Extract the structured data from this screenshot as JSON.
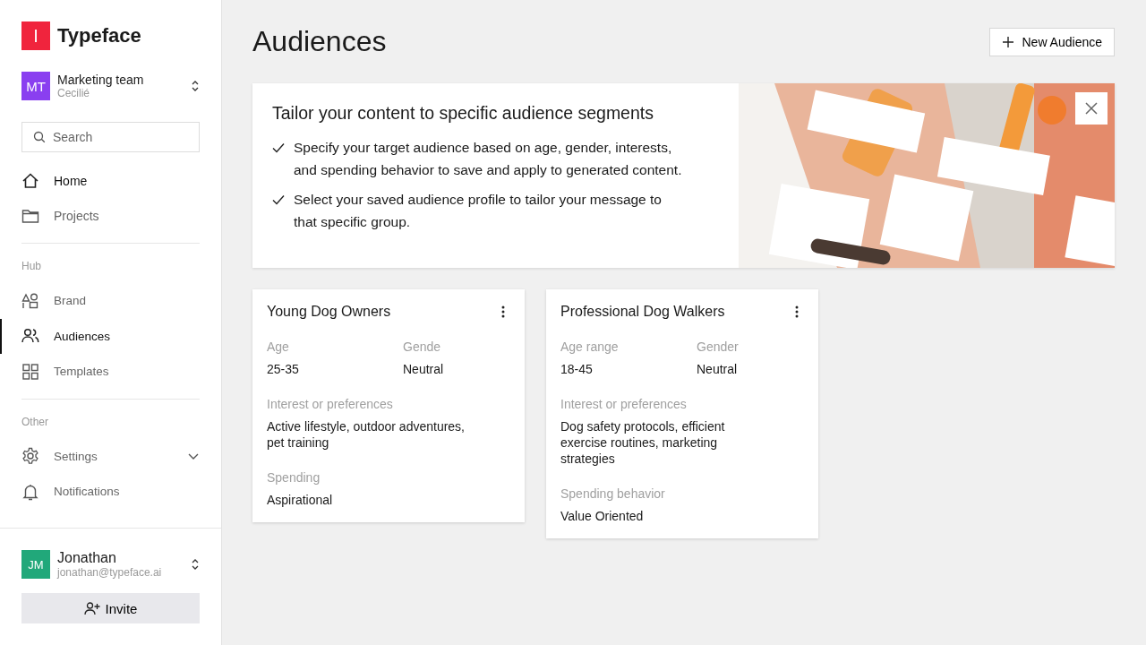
{
  "brand": {
    "name": "Typeface",
    "mark": "I"
  },
  "workspace": {
    "initials": "MT",
    "name": "Marketing team",
    "user": "Cecilié"
  },
  "search": {
    "placeholder": "Search"
  },
  "nav": [
    {
      "label": "Home",
      "selected": false,
      "hovered": true
    },
    {
      "label": "Projects",
      "selected": false,
      "hovered": false
    }
  ],
  "sections": [
    {
      "title": "Hub",
      "items": [
        {
          "label": "Brand",
          "selected": false,
          "kind": "link"
        },
        {
          "label": "Audiences",
          "selected": true,
          "kind": "link"
        },
        {
          "label": "Templates",
          "selected": false,
          "kind": "link"
        }
      ]
    },
    {
      "title": "Other",
      "items": [
        {
          "label": "Settings",
          "selected": false,
          "kind": "group",
          "expanded": false
        },
        {
          "label": "Notifications",
          "selected": false,
          "kind": "link"
        }
      ]
    }
  ],
  "account": {
    "initials": "JM",
    "name": "Jonathan",
    "email": "jonathan@typeface.ai"
  },
  "invite_button": "Invite",
  "page_title": "Audiences",
  "new_button": "New Audience",
  "banner": {
    "title": "Tailor your content to specific audience segments",
    "points": [
      "Specify your target audience based on age, gender, interests, and spending behavior to save and apply to generated content.",
      "Select your saved audience profile to tailor your message to that specific group."
    ],
    "image": {
      "kind": "picture"
    }
  },
  "audiences": [
    {
      "title": "Young Dog Owners",
      "fields": [
        {
          "label": "Age",
          "value": "25-35"
        },
        {
          "label": "Gende",
          "value": "Neutral"
        },
        {
          "label": "Interest or preferences",
          "value": "Active lifestyle, outdoor adventures, pet training"
        },
        {
          "label": "Spending",
          "value": "Aspirational"
        }
      ]
    },
    {
      "title": "Professional Dog Walkers",
      "fields": [
        {
          "label": "Age range",
          "value": "18-45"
        },
        {
          "label": "Gender",
          "value": "Neutral"
        },
        {
          "label": "Interest or preferences",
          "value": "Dog safety protocols, efficient exercise routines, marketing strategies"
        },
        {
          "label": "Spending behavior",
          "value": "Value Oriented"
        }
      ]
    }
  ]
}
